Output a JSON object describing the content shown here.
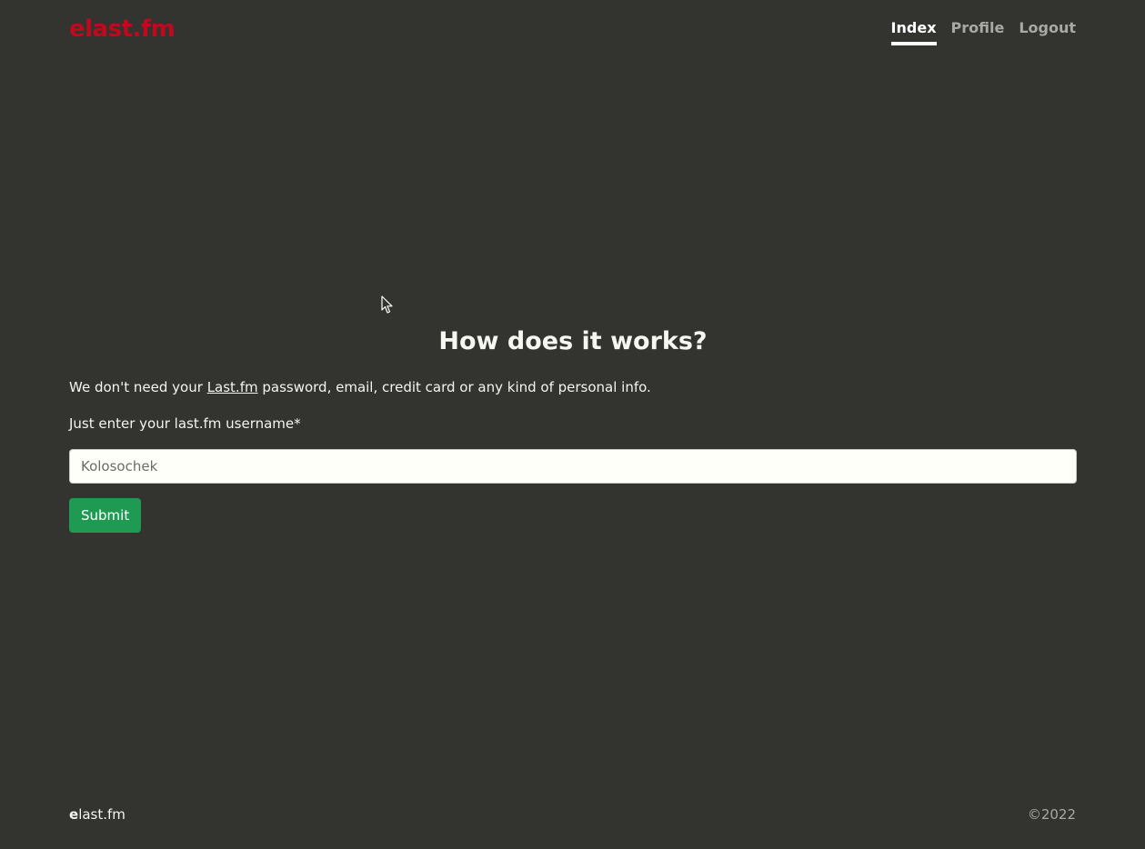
{
  "header": {
    "brand": "elast.fm",
    "nav": [
      {
        "label": "Index",
        "active": true
      },
      {
        "label": "Profile",
        "active": false
      },
      {
        "label": "Logout",
        "active": false
      }
    ]
  },
  "main": {
    "title": "How does it works?",
    "lead_before": "We don't need your ",
    "lead_link": "Last.fm",
    "lead_after": " password, email, credit card or any kind of personal info.",
    "username_label": "Just enter your last.fm username*",
    "username_placeholder": "Kolosochek",
    "username_value": "",
    "submit_label": "Submit"
  },
  "footer": {
    "brand_prefix": "e",
    "brand_rest": "last.fm",
    "copyright": "©2022"
  },
  "colors": {
    "background": "#33332f",
    "brand": "#c0081e",
    "submit": "#1f9a52"
  }
}
